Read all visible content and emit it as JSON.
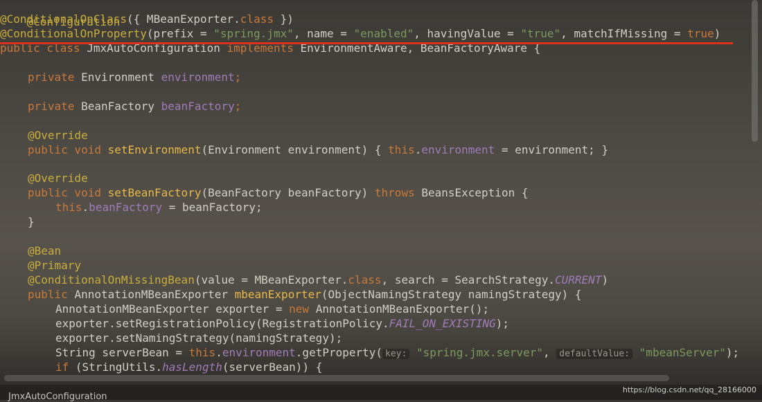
{
  "code": {
    "l1_annot": "@Configuration",
    "l2_annot": "@ConditionalOnClass",
    "l2_rest": "({ MBeanExporter.",
    "l2_class": "class",
    "l2_end": " })",
    "l3_annot": "@ConditionalOnProperty",
    "l3_p1": "(prefix = ",
    "l3_s1": "\"spring.jmx\"",
    "l3_p2": ", name = ",
    "l3_s2": "\"enabled\"",
    "l3_p3": ", havingValue = ",
    "l3_s3": "\"true\"",
    "l3_p4": ", matchIfMissing = ",
    "l3_kw": "true",
    "l3_end": ")",
    "l4_kw": "public class ",
    "l4_name": "JmxAutoConfiguration ",
    "l4_impl": "implements ",
    "l4_rest": "EnvironmentAware, BeanFactoryAware {",
    "l6_kw": "private ",
    "l6_type": "Environment ",
    "l6_fld": "environment",
    "l6_end": ";",
    "l8_kw": "private ",
    "l8_type": "BeanFactory ",
    "l8_fld": "beanFactory",
    "l8_end": ";",
    "l10_annot": "@Override",
    "l11_kw": "public void ",
    "l11_fn": "setEnvironment",
    "l11_p1": "(Environment environment) { ",
    "l11_this": "this",
    "l11_dot": ".",
    "l11_fld": "environment",
    "l11_end": " = environment; }",
    "l13_annot": "@Override",
    "l14_kw": "public void ",
    "l14_fn": "setBeanFactory",
    "l14_p1": "(BeanFactory beanFactory) ",
    "l14_throws": "throws ",
    "l14_end": "BeansException {",
    "l15_this": "this",
    "l15_dot": ".",
    "l15_fld": "beanFactory",
    "l15_end": " = beanFactory;",
    "l16_brace": "}",
    "l18_annot": "@Bean",
    "l19_annot": "@Primary",
    "l20_annot": "@ConditionalOnMissingBean",
    "l20_p1": "(value = MBeanExporter.",
    "l20_class": "class",
    "l20_p2": ", search = SearchStrategy.",
    "l20_it": "CURRENT",
    "l20_end": ")",
    "l21_kw": "public ",
    "l21_type": "AnnotationMBeanExporter ",
    "l21_fn": "mbeanExporter",
    "l21_end": "(ObjectNamingStrategy namingStrategy) {",
    "l22_p1": "AnnotationMBeanExporter exporter = ",
    "l22_new": "new ",
    "l22_end": "AnnotationMBeanExporter();",
    "l23_p1": "exporter.setRegistrationPolicy(RegistrationPolicy.",
    "l23_it": "FAIL_ON_EXISTING",
    "l23_end": ");",
    "l24_p1": "exporter.setNamingStrategy(namingStrategy);",
    "l25_p1": "String serverBean = ",
    "l25_this": "this",
    "l25_dot": ".",
    "l25_fld": "environment",
    "l25_p2": ".getProperty(",
    "l25_h1": "key:",
    "l25_s1": "\"spring.jmx.server\"",
    "l25_comma": ", ",
    "l25_h2": "defaultValue:",
    "l25_s2": "\"mbeanServer\"",
    "l25_end": ");",
    "l26_if": "if ",
    "l26_p1": "(StringUtils.",
    "l26_it": "hasLength",
    "l26_end": "(serverBean)) {"
  },
  "status": {
    "breadcrumb": "JmxAutoConfiguration",
    "watermark": "https://blog.csdn.net/qq_28166000"
  }
}
